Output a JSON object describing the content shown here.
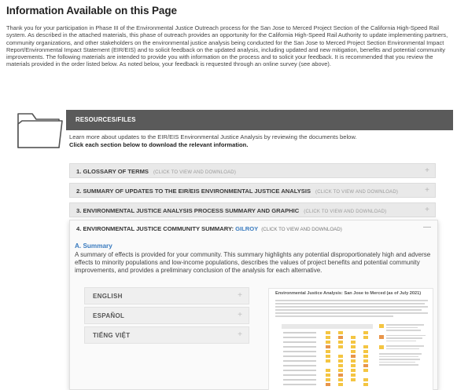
{
  "page": {
    "title": "Information Available on this Page",
    "intro": "Thank you for your participation in Phase III of the Environmental Justice Outreach process for the San Jose to Merced Project Section of the California High-Speed Rail system. As described in the attached materials, this phase of outreach provides an opportunity for the California High-Speed Rail Authority to update implementing partners, community organizations, and other stakeholders on the environmental justice analysis being conducted for the San Jose to Merced Project Section Environmental Impact Report/Environmental Impact Statement (EIR/EIS) and to solicit feedback on the updated analysis, including updated and new mitigation, benefits and potential community improvements. The following materials are intended to provide you with information on the process and to solicit your feedback. It is recommended that you review the materials provided in the order listed below. As noted below, your feedback is requested through an online survey (see above)."
  },
  "resources": {
    "title": "RESOURCES/FILES",
    "description": "Learn more about updates to the EIR/EIS Environmental Justice Analysis by reviewing the documents below.",
    "cta": "Click each section below to download the relevant information.",
    "icon": "folder-icon"
  },
  "accordion": [
    {
      "label": "1. GLOSSARY OF TERMS",
      "hint": "(CLICK TO VIEW AND DOWNLOAD)",
      "toggle": "+"
    },
    {
      "label": "2. SUMMARY OF UPDATES TO THE EIR/EIS ENVIRONMENTAL JUSTICE ANALYSIS",
      "hint": "(CLICK TO VIEW AND DOWNLOAD)",
      "toggle": "+"
    },
    {
      "label": "3. ENVIRONMENTAL JUSTICE ANALYSIS PROCESS SUMMARY AND GRAPHIC",
      "hint": "(CLICK TO VIEW AND DOWNLOAD)",
      "toggle": "+"
    }
  ],
  "expanded": {
    "label": "4. ENVIRONMENTAL JUSTICE COMMUNITY SUMMARY: ",
    "community": "GILROY",
    "hint": "(CLICK TO VIEW AND DOWNLOAD)",
    "toggle": "—",
    "summary_title": "A. Summary",
    "summary_text": "A summary of effects is provided for your community. This summary highlights any potential disproportionately high and adverse effects to minority populations and low-income populations, describes the values of project benefits and potential community improvements, and provides a preliminary conclusion of the analysis for each alternative.",
    "languages": [
      {
        "label": "ENGLISH",
        "toggle": "+"
      },
      {
        "label": "ESPAÑOL",
        "toggle": "+"
      },
      {
        "label": "TIẾNG VIỆT",
        "toggle": "+"
      }
    ],
    "preview_title": "Environmental Justice Analysis: San Jose to Merced (as of July 2021)"
  },
  "colors": {
    "accent_blue": "#3a7bbf",
    "resource_bar": "#5a5a5a",
    "preview_yellow": "#f4c542",
    "preview_orange": "#e8954a"
  }
}
